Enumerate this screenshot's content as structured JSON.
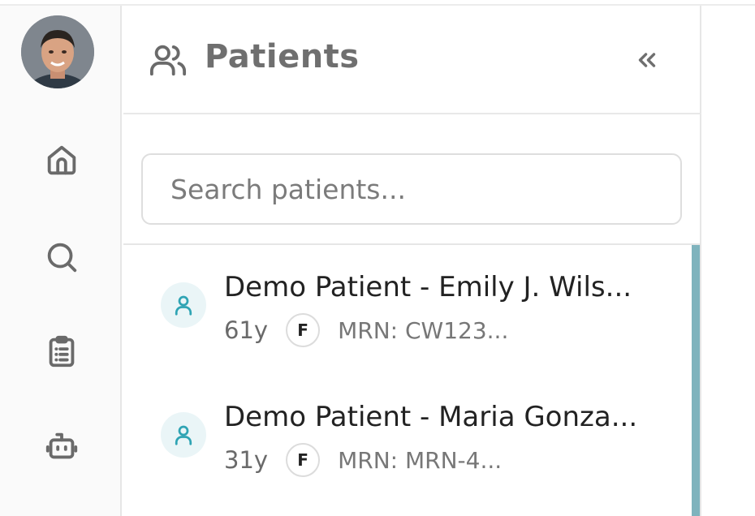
{
  "panel": {
    "title": "Patients",
    "collapse_icon": "chevrons-left-icon",
    "header_icon": "users-icon"
  },
  "rail": {
    "avatar": "user-avatar",
    "items": [
      {
        "icon": "home-icon"
      },
      {
        "icon": "search-icon"
      },
      {
        "icon": "clipboard-list-icon"
      },
      {
        "icon": "bot-icon"
      }
    ]
  },
  "search": {
    "placeholder": "Search patients...",
    "value": ""
  },
  "patients": [
    {
      "name": "Demo Patient - Emily J. Wils...",
      "age": "61y",
      "sex": "F",
      "mrn": "MRN: CW123..."
    },
    {
      "name": "Demo Patient - Maria Gonza...",
      "age": "31y",
      "sex": "F",
      "mrn": "MRN: MRN-4..."
    }
  ],
  "colors": {
    "accent": "#2fa4b4",
    "scrollbar": "#7fb3bd",
    "icon": "#6a6a6a"
  }
}
